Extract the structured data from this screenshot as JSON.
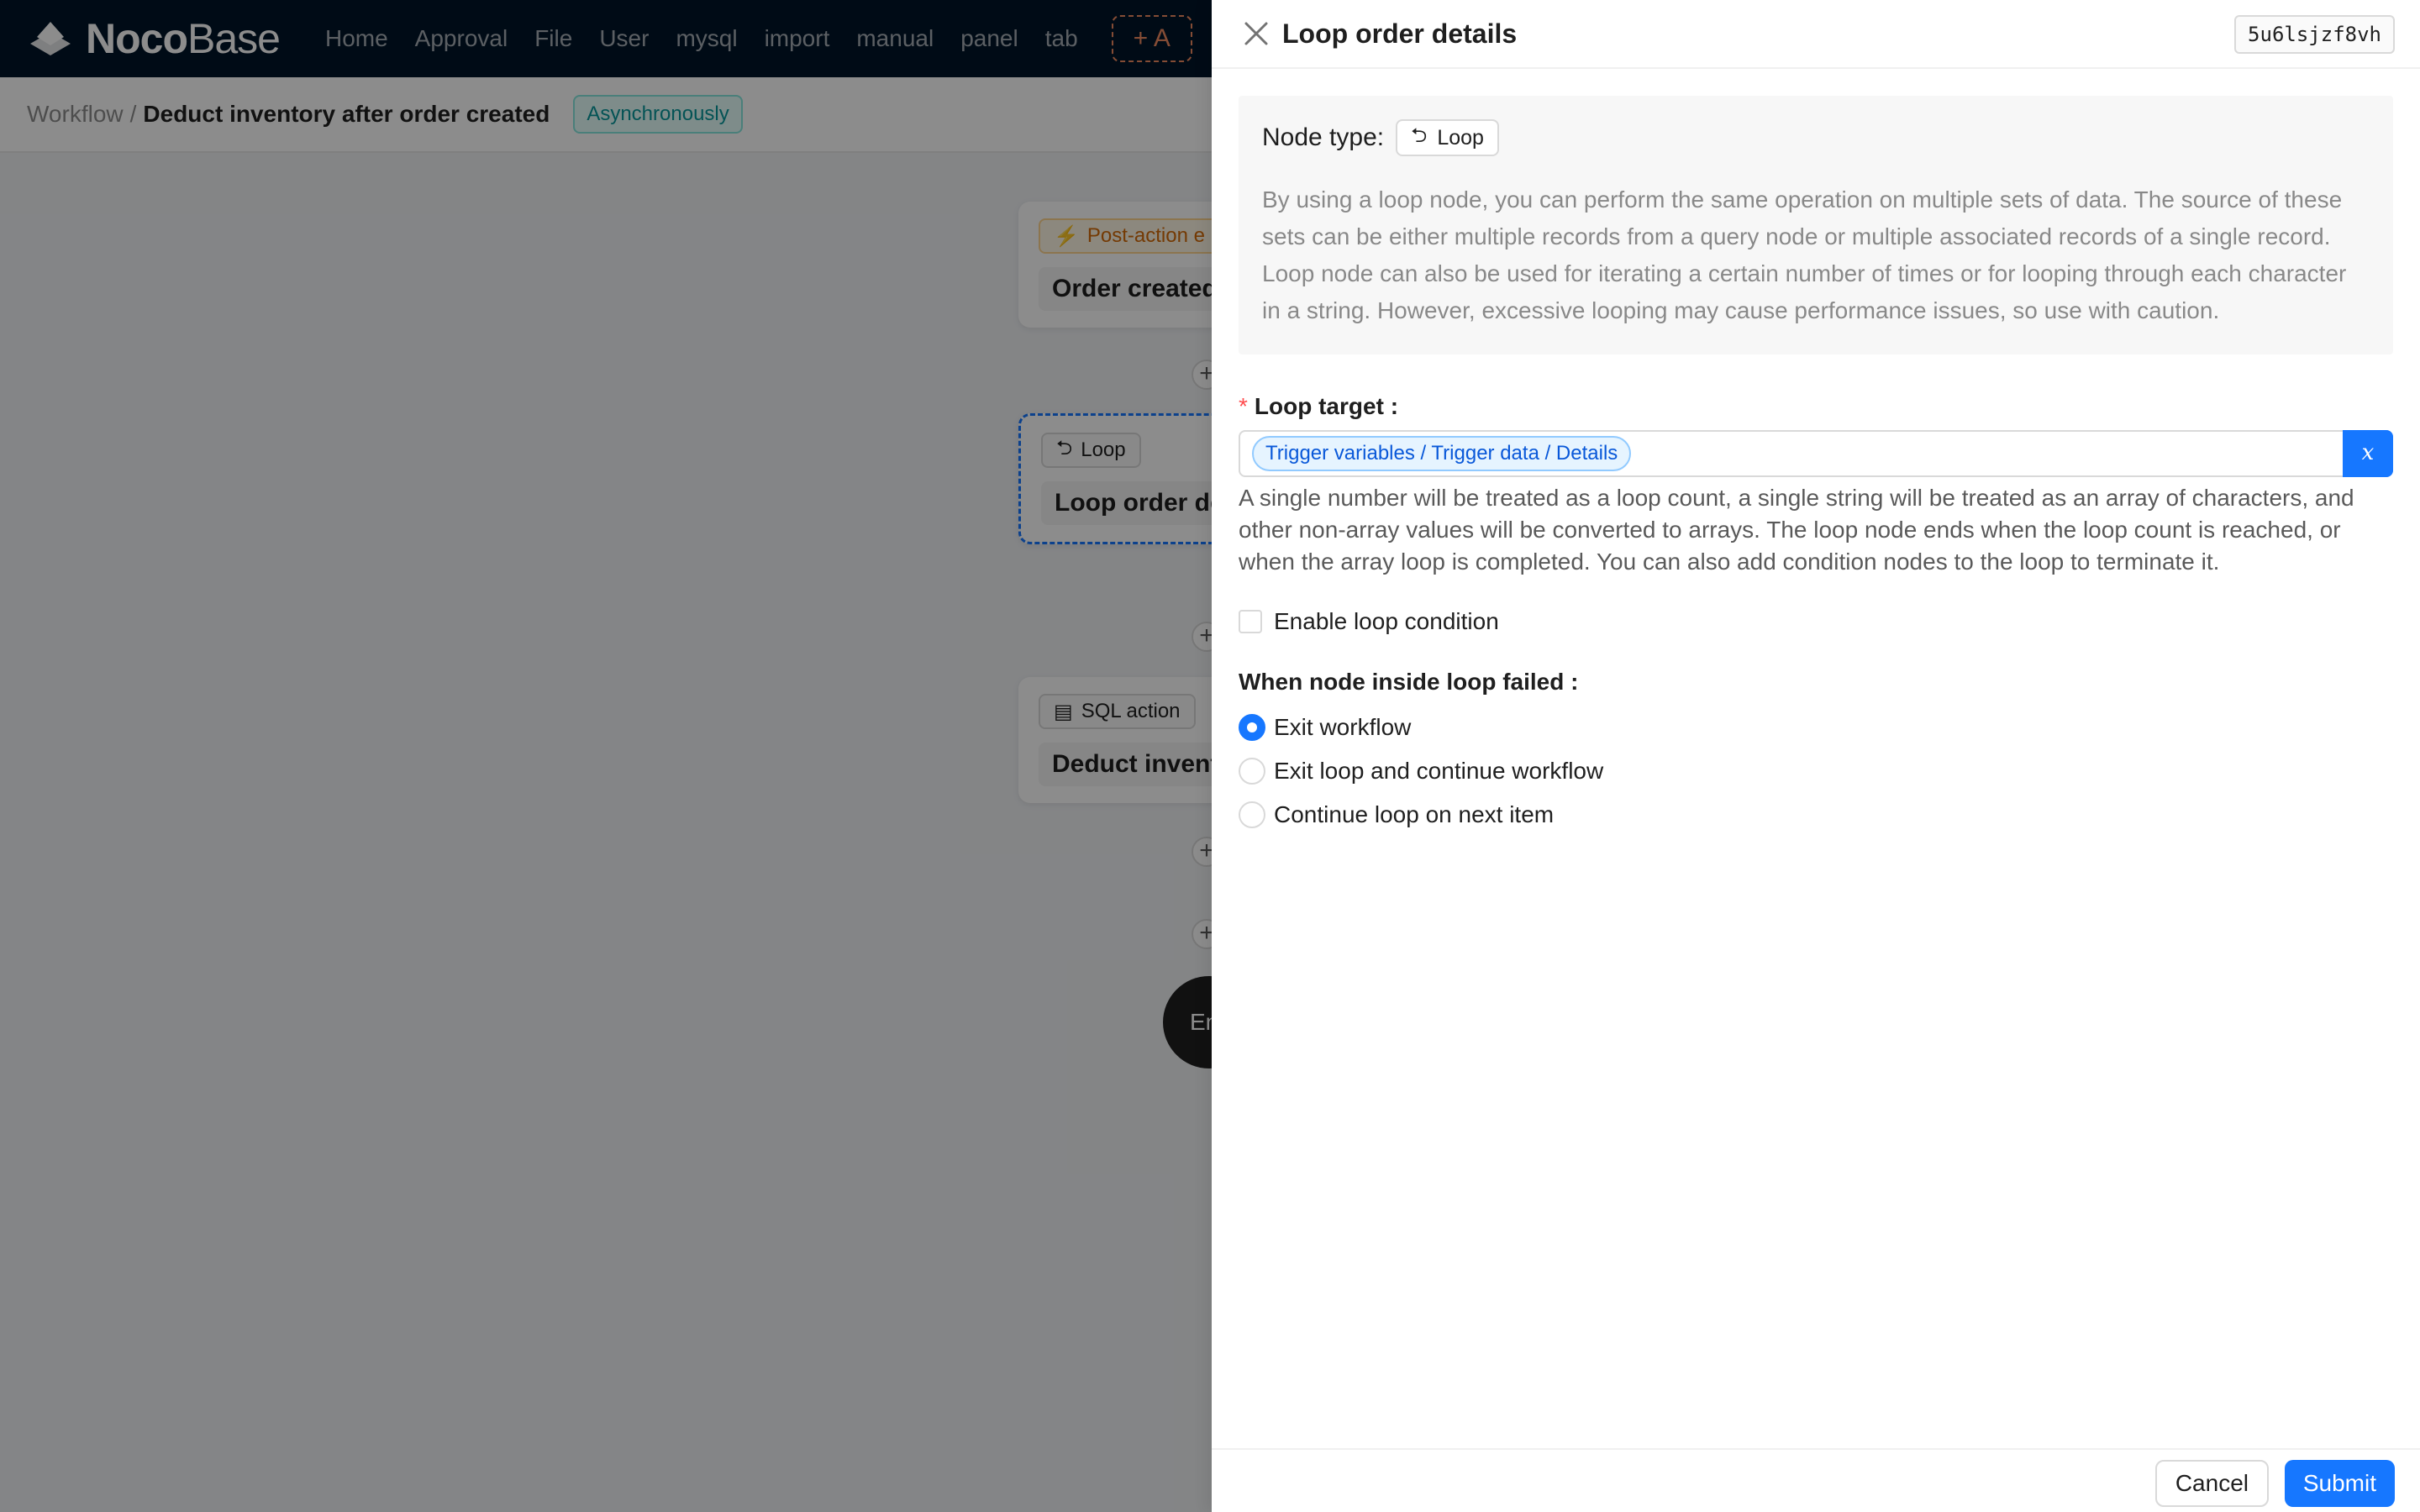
{
  "app": {
    "logo": {
      "bold": "Noco",
      "thin": "Base"
    },
    "nav": [
      "Home",
      "Approval",
      "File",
      "User",
      "mysql",
      "import",
      "manual",
      "panel",
      "tab"
    ],
    "add_menu_label": "+ A"
  },
  "breadcrumb": {
    "parent": "Workflow",
    "separator": "/",
    "current": "Deduct inventory after order created",
    "mode_tag": "Asynchronously"
  },
  "canvas": {
    "trigger": {
      "tag": "Post-action e",
      "title": "Order created"
    },
    "loop_node": {
      "tag": "Loop",
      "title": "Loop order de"
    },
    "sql_node": {
      "tag": "SQL action",
      "title": "Deduct invent"
    },
    "end_label": "En"
  },
  "drawer": {
    "title": "Loop order details",
    "node_key": "5u6lsjzf8vh",
    "node_type_label": "Node type:",
    "node_type_value": "Loop",
    "description": "By using a loop node, you can perform the same operation on multiple sets of data. The source of these sets can be either multiple records from a query node or multiple associated records of a single record. Loop node can also be used for iterating a certain number of times or for looping through each character in a string. However, excessive looping may cause performance issues, so use with caution.",
    "loop_target": {
      "label": "Loop target",
      "colon": ":",
      "value_tag": "Trigger variables / Trigger data / Details",
      "var_button": "x",
      "help": "A single number will be treated as a loop count, a single string will be treated as an array of characters, and other non-array values will be converted to arrays. The loop node ends when the loop count is reached, or when the array loop is completed. You can also add condition nodes to the loop to terminate it."
    },
    "enable_condition_label": "Enable loop condition",
    "failure": {
      "label": "When node inside loop failed",
      "colon": ":",
      "options": [
        "Exit workflow",
        "Exit loop and continue workflow",
        "Continue loop on next item"
      ],
      "selected": "Exit workflow"
    },
    "footer": {
      "cancel": "Cancel",
      "submit": "Submit"
    }
  },
  "colors": {
    "primary": "#1677ff",
    "header_bg": "#001529",
    "required": "#ff4d4f"
  }
}
